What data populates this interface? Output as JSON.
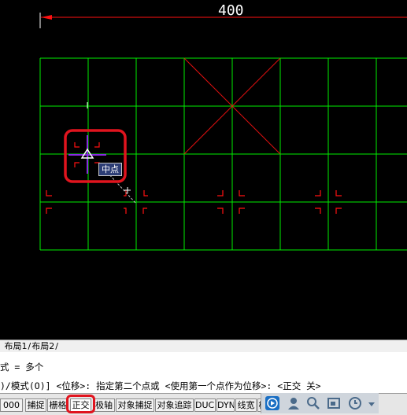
{
  "canvas": {
    "dimension_value": "400",
    "tooltip_label": "中点",
    "colors": {
      "background": "#000000",
      "grid": "#00ff00",
      "diagonal": "#ff0000",
      "marker": "#ff0000",
      "highlight": "#e0141e"
    }
  },
  "layout_tabs": {
    "tab1": "布局1",
    "tab2": "布局2"
  },
  "command_line": {
    "row1": "式 = 多个",
    "row2": ")/模式(O)] <位移>: 指定第二个点或 <使用第一个点作为位移>: <正交 关>"
  },
  "status_bar": {
    "coord": "000",
    "buttons": [
      "捕捉",
      "栅格",
      "正交",
      "极轴",
      "对象捕捉",
      "对象追踪",
      "DUCS",
      "DYN",
      "线宽",
      "模"
    ],
    "active_button": "正交"
  },
  "tray_icons": [
    "play-icon",
    "user-icon",
    "search-icon",
    "window-icon",
    "clock-icon",
    "menu-icon"
  ]
}
